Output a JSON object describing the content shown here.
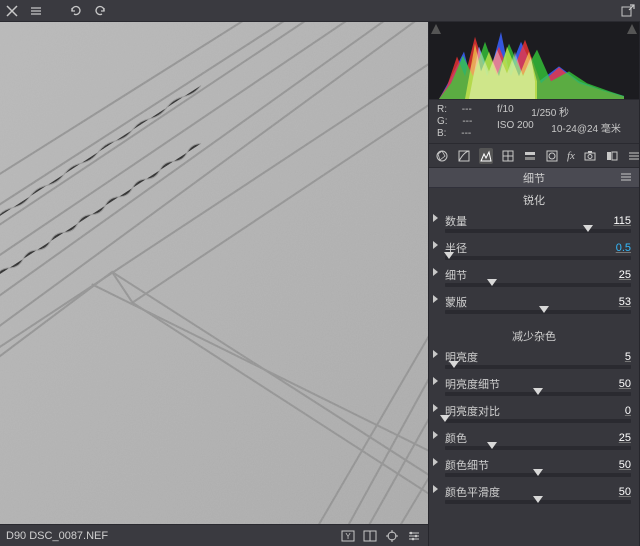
{
  "toolbar": {},
  "footer": {
    "filename": "D90   DSC_0087.NEF"
  },
  "meta": {
    "r_label": "R:",
    "r_val": "---",
    "g_label": "G:",
    "g_val": "---",
    "b_label": "B:",
    "b_val": "---",
    "f": "f/10",
    "shutter": "1/250 秒",
    "iso": "ISO 200",
    "lens": "10-24@24 毫米"
  },
  "panel": {
    "title": "细节",
    "group1": "锐化",
    "sliders1": [
      {
        "label": "数量",
        "value": "115",
        "pos": 77
      },
      {
        "label": "半径",
        "value": "0.5",
        "pos": 2,
        "hl": true
      },
      {
        "label": "细节",
        "value": "25",
        "pos": 25
      },
      {
        "label": "蒙版",
        "value": "53",
        "pos": 53
      }
    ],
    "group2": "减少杂色",
    "sliders2": [
      {
        "label": "明亮度",
        "value": "5",
        "pos": 5
      },
      {
        "label": "明亮度细节",
        "value": "50",
        "pos": 50
      },
      {
        "label": "明亮度对比",
        "value": "0",
        "pos": 0
      },
      {
        "label": "颜色",
        "value": "25",
        "pos": 25
      },
      {
        "label": "颜色细节",
        "value": "50",
        "pos": 50
      },
      {
        "label": "颜色平滑度",
        "value": "50",
        "pos": 50
      }
    ]
  }
}
